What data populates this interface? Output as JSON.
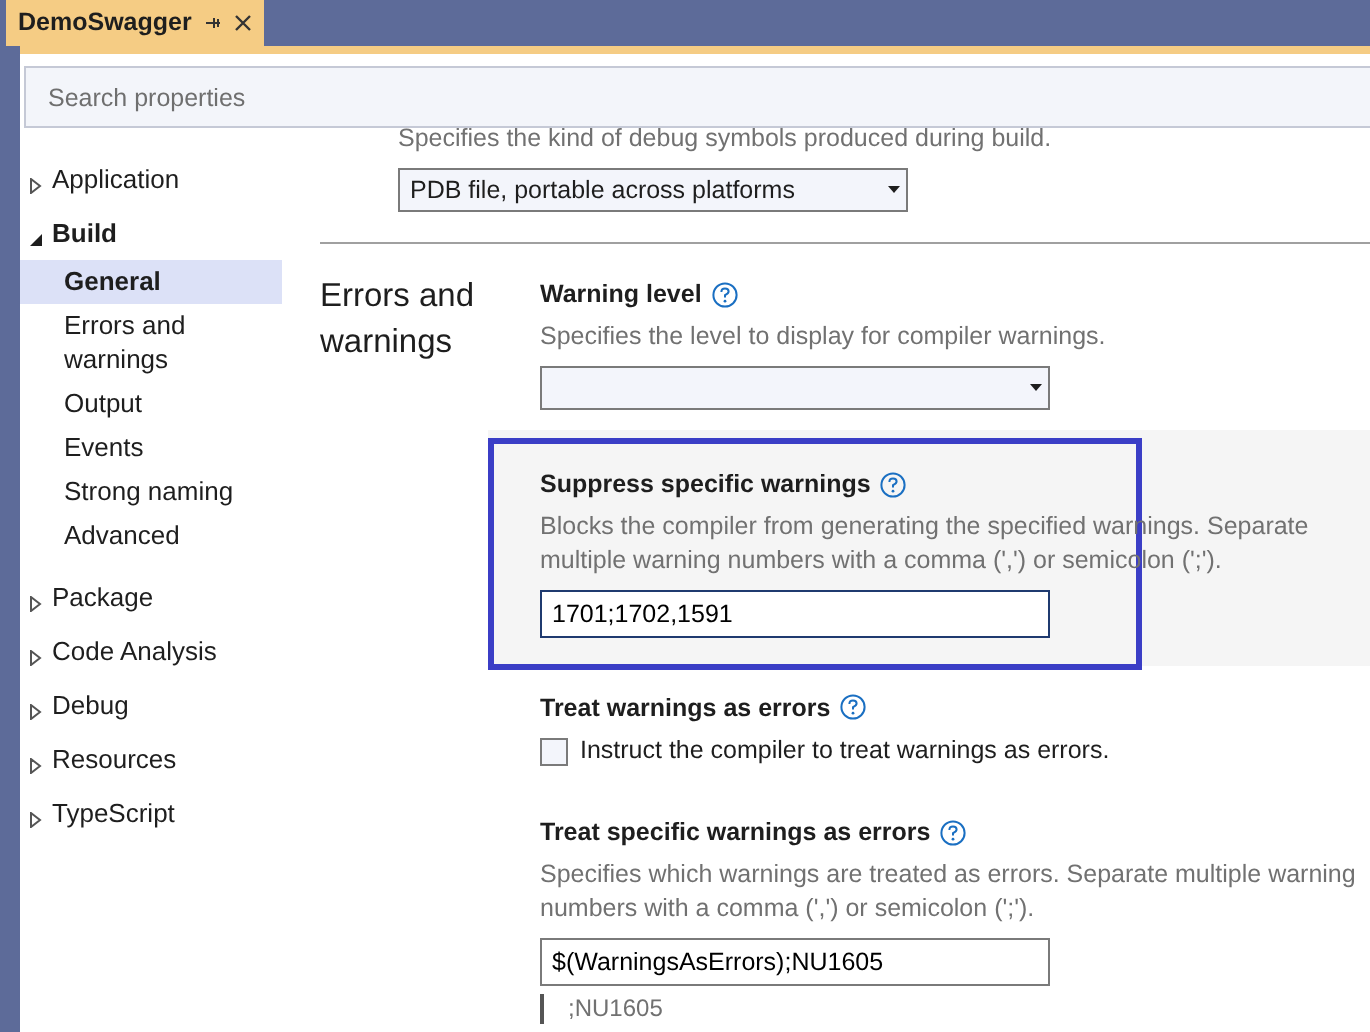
{
  "tab": {
    "title": "DemoSwagger",
    "selected": true
  },
  "search": {
    "placeholder": "Search properties"
  },
  "sidebar": {
    "items": [
      {
        "label": "Application",
        "expanded": false,
        "selected": false
      },
      {
        "label": "Build",
        "expanded": true,
        "selected": false,
        "children": [
          {
            "label": "General",
            "selected": true
          },
          {
            "label": "Errors and warnings",
            "selected": false
          },
          {
            "label": "Output",
            "selected": false
          },
          {
            "label": "Events",
            "selected": false
          },
          {
            "label": "Strong naming",
            "selected": false
          },
          {
            "label": "Advanced",
            "selected": false
          }
        ]
      },
      {
        "label": "Package",
        "expanded": false,
        "selected": false
      },
      {
        "label": "Code Analysis",
        "expanded": false,
        "selected": false
      },
      {
        "label": "Debug",
        "expanded": false,
        "selected": false
      },
      {
        "label": "Resources",
        "expanded": false,
        "selected": false
      },
      {
        "label": "TypeScript",
        "expanded": false,
        "selected": false
      }
    ]
  },
  "previous_setting": {
    "description": "Specifies the kind of debug symbols produced during build.",
    "value": "PDB file, portable across platforms"
  },
  "section": {
    "title": "Errors and warnings",
    "settings": [
      {
        "kind": "dropdown",
        "label": "Warning level",
        "description": "Specifies the level to display for compiler warnings.",
        "highlighted": false
      },
      {
        "kind": "text",
        "label": "Suppress specific warnings",
        "description": "Blocks the compiler from generating the specified warnings. Separate multiple warning numbers with a comma (',') or semicolon (';').",
        "value": "1701;1702,1591",
        "highlighted": true
      },
      {
        "kind": "checkbox",
        "label": "Treat warnings as errors",
        "option": "Instruct the compiler to treat warnings as errors.",
        "checked": false,
        "highlighted": false
      },
      {
        "kind": "text",
        "label": "Treat specific warnings as errors",
        "description": "Specifies which warnings are treated as errors. Separate multiple warning numbers with a comma (',') or semicolon (';').",
        "value": "$(WarningsAsErrors);NU1605",
        "evaluated": ";NU1605",
        "highlighted": false
      }
    ]
  }
}
